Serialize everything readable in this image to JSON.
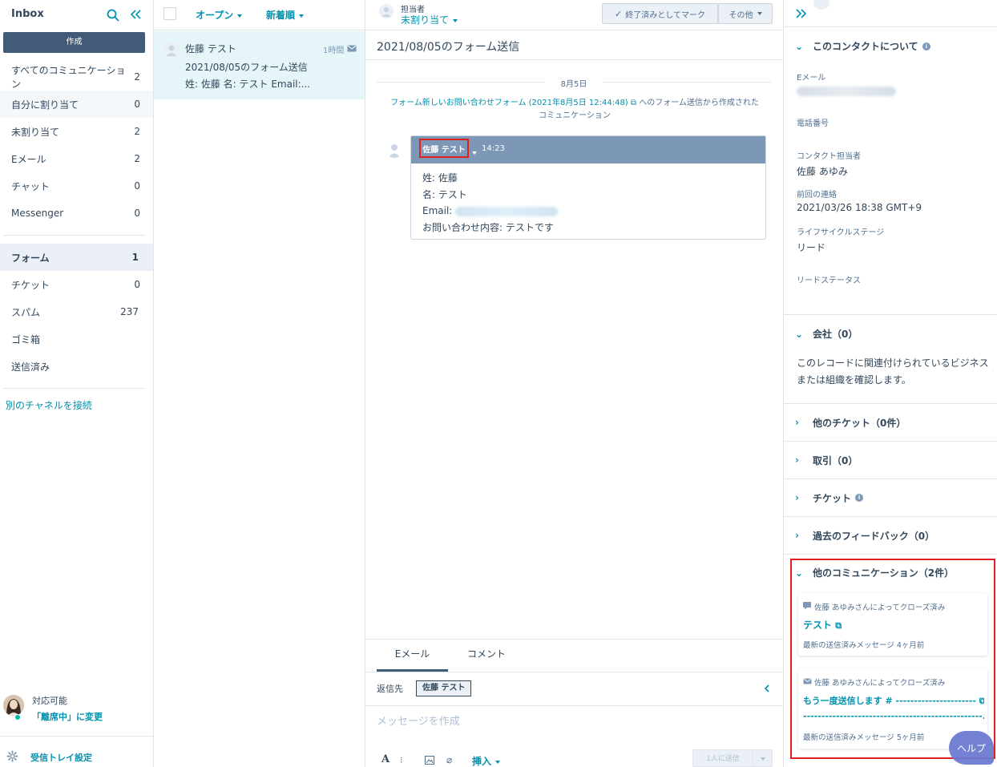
{
  "sidebar": {
    "title": "Inbox",
    "compose_label": "作成",
    "items": [
      {
        "label": "すべてのコミュニケーション",
        "count": "2"
      },
      {
        "label": "自分に割り当て",
        "count": "0"
      },
      {
        "label": "未割り当て",
        "count": "2"
      },
      {
        "label": "Eメール",
        "count": "2"
      },
      {
        "label": "チャット",
        "count": "0"
      },
      {
        "label": "Messenger",
        "count": "0"
      }
    ],
    "items2": [
      {
        "label": "フォーム",
        "count": "1"
      },
      {
        "label": "チケット",
        "count": "0"
      },
      {
        "label": "スパム",
        "count": "237"
      },
      {
        "label": "ゴミ箱",
        "count": ""
      },
      {
        "label": "送信済み",
        "count": ""
      }
    ],
    "connect_link": "別のチャネルを接続",
    "status": {
      "label": "対応可能",
      "change_link": "「離席中」に変更"
    },
    "settings_label": "受信トレイ設定"
  },
  "convlist": {
    "filter_status": "オープン",
    "sort": "新着順",
    "item": {
      "name": "佐藤 テスト",
      "time": "1時間",
      "subject": "2021/08/05のフォーム送信",
      "preview": "姓: 佐藤 名: テスト Email:..."
    }
  },
  "main": {
    "assignee_label": "担当者",
    "assignee_value": "未割り当て",
    "mark_done": "終了済みとしてマーク",
    "more": "その他",
    "thread_title": "2021/08/05のフォーム送信",
    "date_sep": "8月5日",
    "form_note_link": "フォーム新しいお問い合わせフォーム (2021年8月5日 12:44:48)",
    "form_note_rest": "へのフォーム送信から作成された",
    "form_note_line2": "コミュニケーション",
    "message": {
      "sender": "佐藤 テスト",
      "time": "14:23",
      "lines": [
        "姓: 佐藤",
        "名: テスト",
        "Email:",
        "お問い合わせ内容: テストです"
      ]
    },
    "composer": {
      "tabs": [
        "Eメール",
        "コメント"
      ],
      "reply_to_label": "返信先",
      "reply_to_value": "佐藤 テスト",
      "placeholder": "メッセージを作成",
      "insert": "挿入",
      "send": "1人に送信"
    }
  },
  "right": {
    "about_title": "このコンタクトについて",
    "props": [
      {
        "label": "Eメール",
        "value": ""
      },
      {
        "label": "電話番号",
        "value": ""
      },
      {
        "label": "コンタクト担当者",
        "value": "佐藤 あゆみ"
      },
      {
        "label": "前回の連絡",
        "value": "2021/03/26 18:38 GMT+9"
      },
      {
        "label": "ライフサイクルステージ",
        "value": "リード"
      },
      {
        "label": "リードステータス",
        "value": ""
      }
    ],
    "company_title": "会社（0）",
    "company_desc_1": "このレコードに関連付けられているビジネス",
    "company_desc_2": "または組織を確認します。",
    "sections": [
      "他のチケット（0件）",
      "取引（0）",
      "チケット",
      "過去のフィードバック（0）"
    ],
    "other_comm_title": "他のコミュニケーション（2件）",
    "cards": [
      {
        "closed_by": "佐藤 あゆみさんによってクローズ済み",
        "title": "テスト",
        "latest": "最新の送信済みメッセージ 4ヶ月前"
      },
      {
        "closed_by": "佐藤 あゆみさんによってクローズ済み",
        "title": "もう一度送信します # ----------------------",
        "title2": "-------------------------------------------------...",
        "latest": "最新の送信済みメッセージ 5ヶ月前"
      }
    ],
    "help_label": "ヘルプ"
  }
}
